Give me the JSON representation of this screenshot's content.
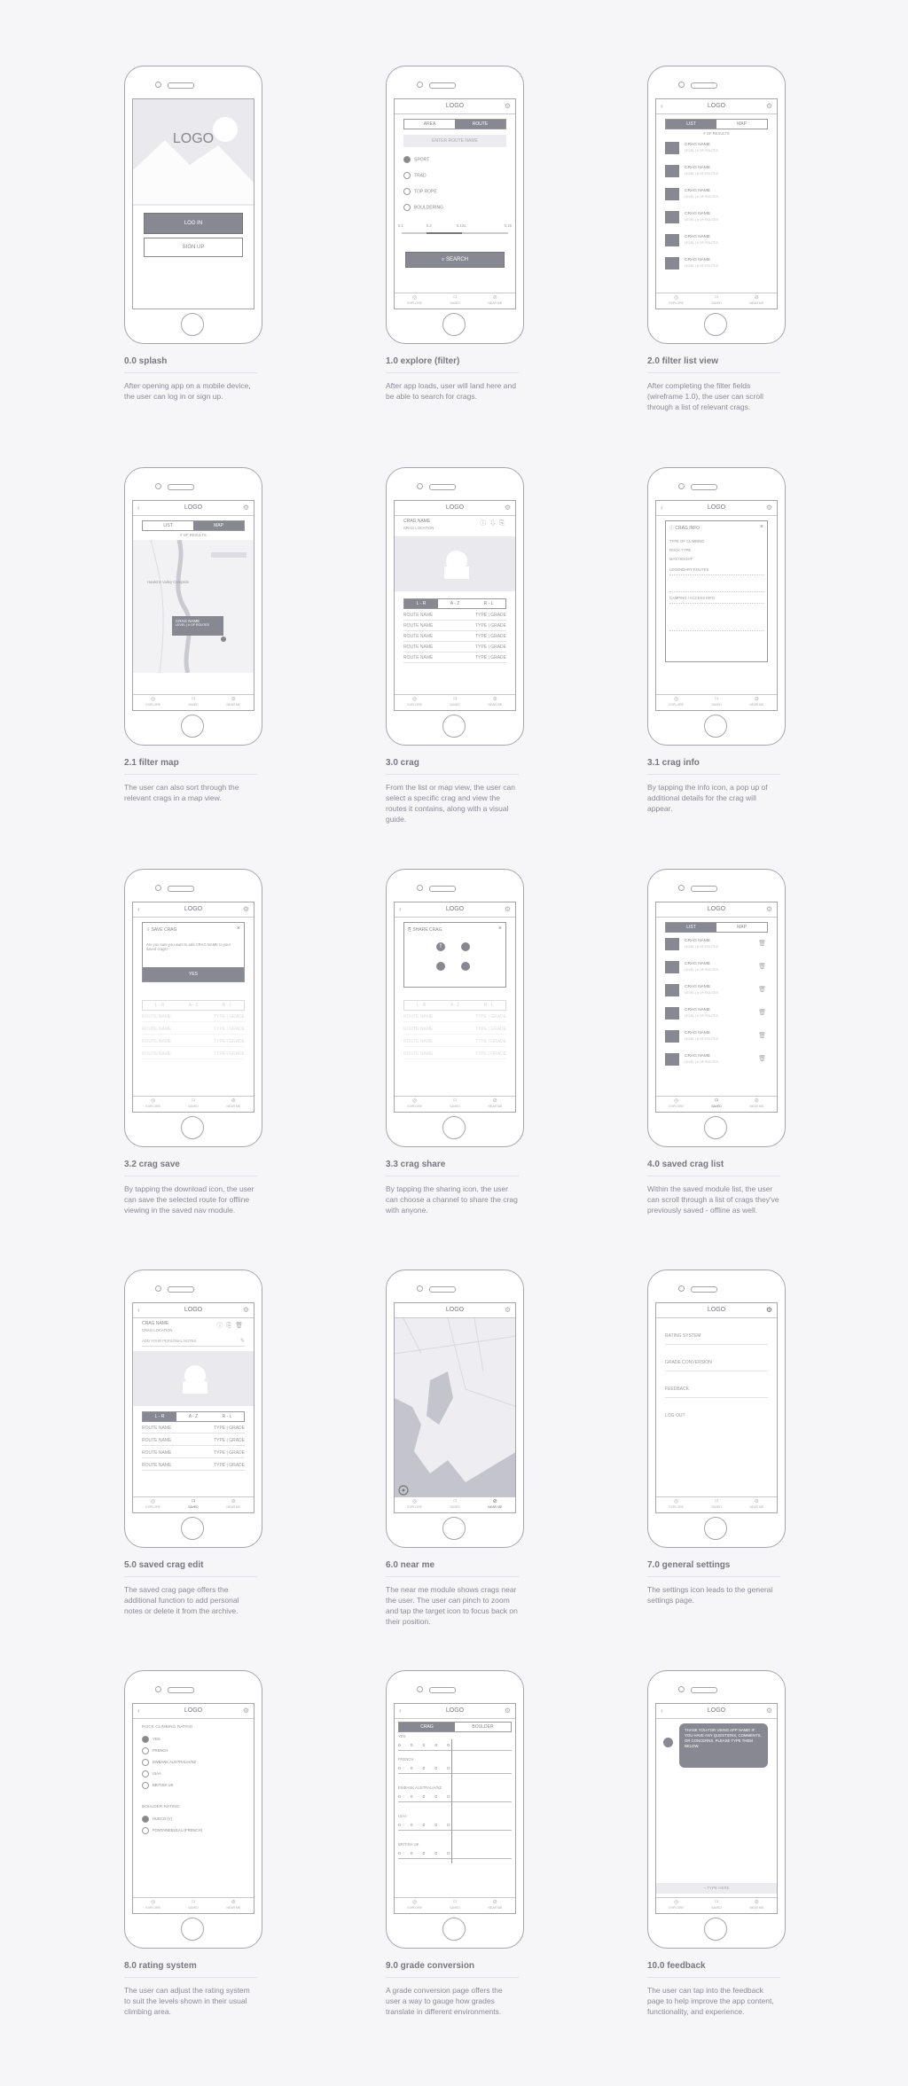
{
  "screens": [
    {
      "label": "0.0 splash",
      "desc": "After opening app on a mobile device, the user can log in or sign up."
    },
    {
      "label": "1.0 explore (filter)",
      "desc": "After app loads, user will land here and be able to search for crags."
    },
    {
      "label": "2.0 filter list view",
      "desc": "After completing the filter fields (wireframe 1.0), the user can scroll through a list of relevant crags."
    },
    {
      "label": "2.1 filter map",
      "desc": "The user can also  sort through the relevant crags in a map view."
    },
    {
      "label": "3.0 crag",
      "desc": "From the list or map view, the user can select a specific crag and view the routes it contains, along with a visual guide."
    },
    {
      "label": "3.1 crag info",
      "desc": "By tapping the info icon, a pop up of additional details for the crag will appear."
    },
    {
      "label": "3.2 crag save",
      "desc": "By tapping the download icon, the user can save the selected route for offline viewing in the saved nav module."
    },
    {
      "label": "3.3 crag share",
      "desc": "By tapping the sharing icon, the user can choose a channel to share the crag with anyone."
    },
    {
      "label": "4.0 saved crag list",
      "desc": "Within the saved module list, the user can scroll through a list of crags they've previously saved - offline as well."
    },
    {
      "label": "5.0 saved crag edit",
      "desc": "The saved crag page offers the additional function to add personal notes or delete it from the archive."
    },
    {
      "label": "6.0 near me",
      "desc": "The near me module shows crags near the user. The user can pinch to zoom and tap the target icon to focus back on their position."
    },
    {
      "label": "7.0 general settings",
      "desc": "The settings icon leads to the general settings page."
    },
    {
      "label": "8.0 rating system",
      "desc": "The user can adjust the rating system to suit the levels shown in their usual climbing area."
    },
    {
      "label": "9.0 grade conversion",
      "desc": "A grade conversion page offers the user a way to gauge how grades translate in different environments."
    },
    {
      "label": "10.0 feedback",
      "desc": "The user can tap into the feedback page to help improve the app content, functionality, and experience."
    }
  ],
  "ui": {
    "logo": "LOGO",
    "login": "LOG IN",
    "signup": "SIGN UP",
    "area": "AREA",
    "route": "ROUTE",
    "enter_route": "ENTER ROUTE NAME",
    "sport": "SPORT",
    "trad": "TRAD",
    "top_rope": "TOP ROPE",
    "bouldering": "BOULDERING",
    "g1": "5.1",
    "g2": "5.2",
    "g3": "5.12a",
    "g4": "5.15",
    "search": "SEARCH",
    "explore": "EXPLORE",
    "saved": "SAVED",
    "near_me": "NEAR ME",
    "list": "LIST",
    "map": "MAP",
    "results": "# OF RESULTS",
    "crag_name": "CRAG NAME",
    "crag_sub": "LEVEL | # OF ROUTES",
    "crag_location": "CRAG LOCATION",
    "map_place": "Hawkins Valley Campsite",
    "sort_lr": "L - R",
    "sort_az": "A - Z",
    "sort_rl": "R - L",
    "route_name": "ROUTE NAME",
    "type_grade": "TYPE | GRADE",
    "crag_info": "CRAG INFO",
    "type_climbing": "TYPE OF CLIMBING",
    "rock_type": "ROCK TYPE",
    "max_height": "MAX HEIGHT",
    "legendary": "LEGENDARY ROUTES",
    "camping": "CAMPING / ACCESS INFO",
    "save_crag": "SAVE CRAG",
    "save_q": "Are you sure you want to add CRAG NAME to your saved crags?",
    "yes": "YES",
    "share_crag": "SHARE CRAG",
    "notes": "ADD YOUR PERSONAL NOTES",
    "rating_system": "RATING SYSTEM",
    "grade_conversion": "GRADE CONVERSION",
    "feedback": "FEEDBACK",
    "log_out": "LOG OUT",
    "rock_rating": "ROCK CLIMBING RATING",
    "yds": "YDS",
    "french": "FRENCH",
    "ewbank": "EWBANK AUSTRALIA/NZ",
    "uiaa": "UIAA",
    "british": "BRITISH UK",
    "boulder_rating": "BOULDER RATING",
    "hueco": "HUECO (V)",
    "font": "FONTAINEBLEAU (FRENCH)",
    "crag_tab": "CRAG",
    "boulder_tab": "BOULDER",
    "ewbank_caps": "EWBANK AUSTRALIA/NZ",
    "thanks": "THANK YOU FOR USING APP NAME! IF YOU HAVE ANY QUESTIONS, COMMENTS, OR CONCERNS, PLEASE TYPE THEM BELOW.",
    "type_here": "TYPE HERE"
  }
}
